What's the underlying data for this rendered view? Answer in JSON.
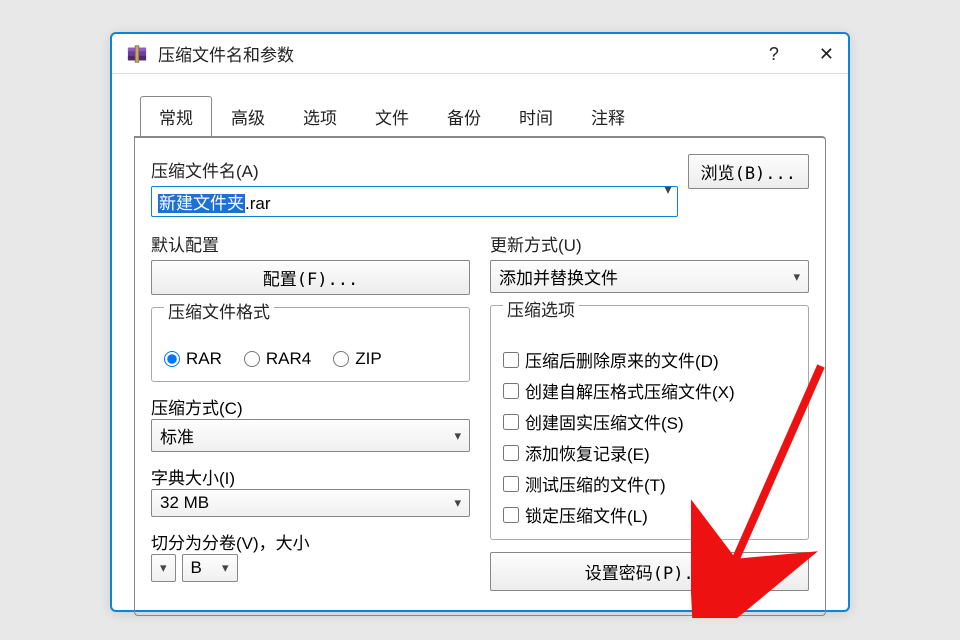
{
  "window": {
    "title": "压缩文件名和参数"
  },
  "titlebar": {
    "help": "?",
    "close": "✕"
  },
  "tabs": {
    "items": [
      "常规",
      "高级",
      "选项",
      "文件",
      "备份",
      "时间",
      "注释"
    ],
    "active_index": 0
  },
  "browse_button": "浏览(B)...",
  "filename": {
    "label": "压缩文件名(A)",
    "value_selected": "新建文件夹",
    "value_suffix": ".rar"
  },
  "default_profile": {
    "label": "默认配置",
    "button": "配置(F)..."
  },
  "update_mode": {
    "label": "更新方式(U)",
    "value": "添加并替换文件"
  },
  "format_group": {
    "legend": "压缩文件格式",
    "options": [
      "RAR",
      "RAR4",
      "ZIP"
    ],
    "selected": "RAR"
  },
  "method": {
    "label": "压缩方式(C)",
    "value": "标准"
  },
  "dictionary": {
    "label": "字典大小(I)",
    "value": "32 MB"
  },
  "split": {
    "label": "切分为分卷(V)，大小",
    "value": "",
    "unit": "B"
  },
  "options_group": {
    "legend": "压缩选项",
    "items": [
      "压缩后删除原来的文件(D)",
      "创建自解压格式压缩文件(X)",
      "创建固实压缩文件(S)",
      "添加恢复记录(E)",
      "测试压缩的文件(T)",
      "锁定压缩文件(L)"
    ]
  },
  "set_password_button": "设置密码(P)..."
}
